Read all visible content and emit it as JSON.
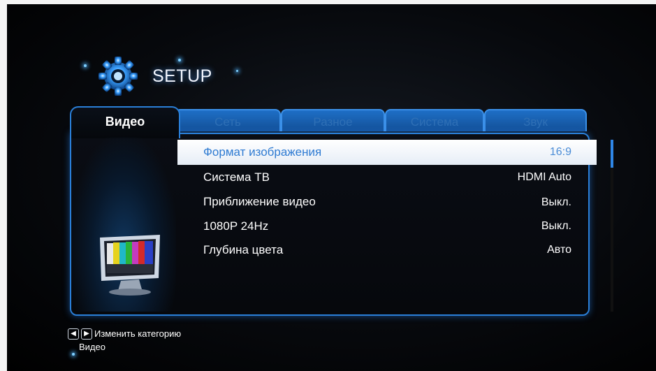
{
  "header": {
    "title": "SETUP",
    "icon": "gear-icon"
  },
  "tabs": [
    {
      "label": "Видео",
      "active": true
    },
    {
      "label": "Сеть",
      "active": false
    },
    {
      "label": "Разное",
      "active": false
    },
    {
      "label": "Система",
      "active": false
    },
    {
      "label": "Звук",
      "active": false
    }
  ],
  "settings": [
    {
      "label": "Формат изображения",
      "value": "16:9",
      "selected": true
    },
    {
      "label": "Система ТВ",
      "value": "HDMI Auto",
      "selected": false
    },
    {
      "label": "Приближение видео",
      "value": "Выкл.",
      "selected": false
    },
    {
      "label": "1080P 24Hz",
      "value": "Выкл.",
      "selected": false
    },
    {
      "label": "Глубина цвета",
      "value": "Авто",
      "selected": false
    }
  ],
  "footer": {
    "hint": "Изменить категорию",
    "category": "Видео",
    "left_icon": "arrow-left-icon",
    "right_icon": "arrow-right-icon"
  },
  "colors": {
    "accent": "#2a7fd8",
    "selection": "#ffffff",
    "selection_text": "#2e7bd2"
  }
}
